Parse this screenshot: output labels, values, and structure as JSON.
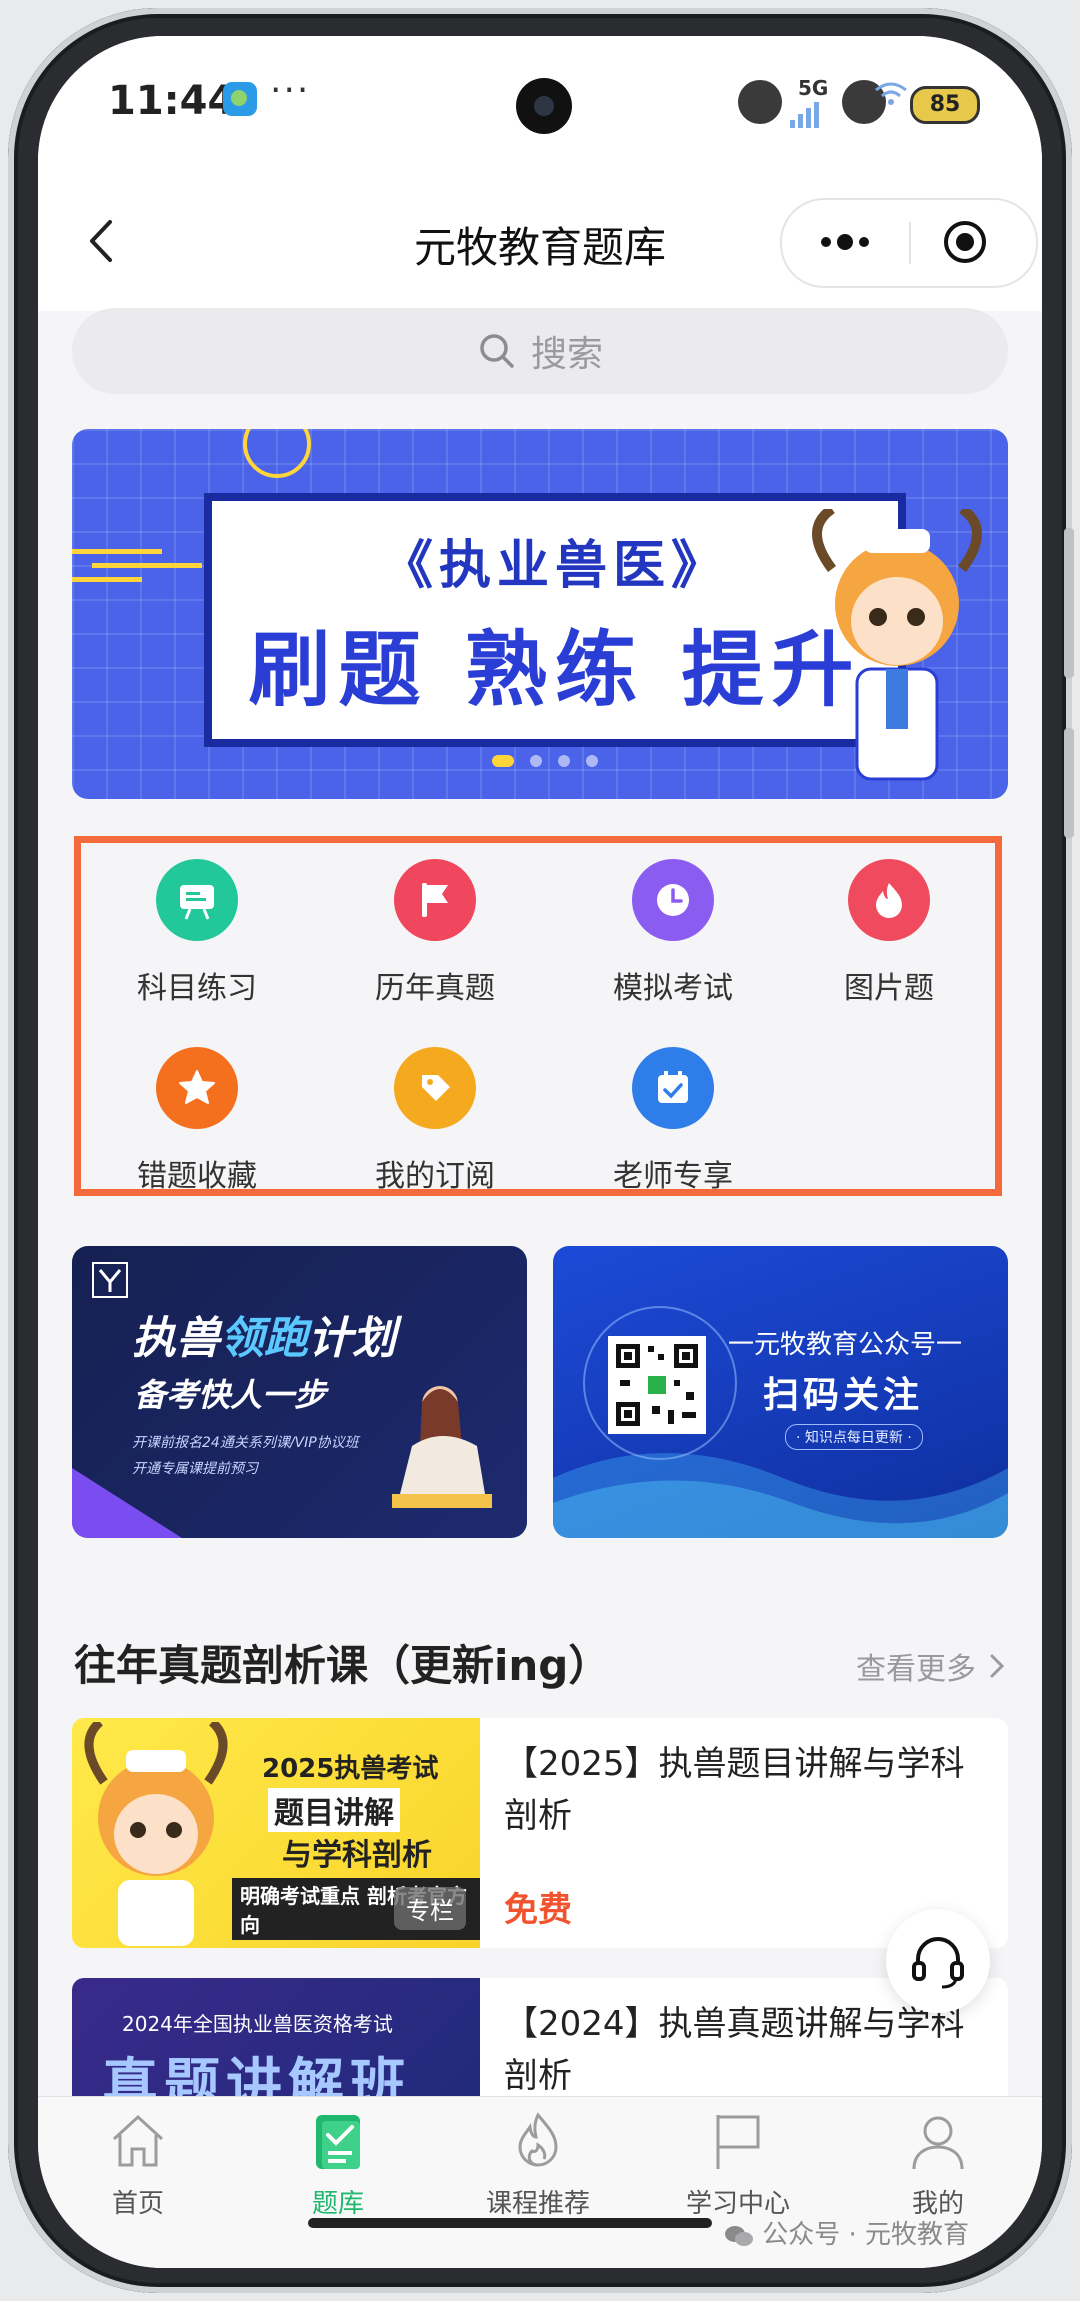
{
  "status_bar": {
    "time": "11:44",
    "network": "5G",
    "battery": "85"
  },
  "nav": {
    "title": "元牧教育题库"
  },
  "search": {
    "placeholder": "搜索"
  },
  "banner": {
    "line1": "《执业兽医》",
    "line2": "刷题 熟练 提升",
    "slides": 4,
    "active_slide": 1
  },
  "grid": {
    "items": [
      {
        "label": "科目练习",
        "icon": "whiteboard-icon",
        "color": "#22c79a"
      },
      {
        "label": "历年真题",
        "icon": "flag-icon",
        "color": "#f0475f"
      },
      {
        "label": "模拟考试",
        "icon": "clock-icon",
        "color": "#8a5cf0"
      },
      {
        "label": "图片题",
        "icon": "flame-icon",
        "color": "#f04a5e"
      },
      {
        "label": "错题收藏",
        "icon": "star-icon",
        "color": "#f5701e"
      },
      {
        "label": "我的订阅",
        "icon": "tag-icon",
        "color": "#f5a91e"
      },
      {
        "label": "老师专享",
        "icon": "calendar-icon",
        "color": "#2e7de8"
      }
    ]
  },
  "promos": {
    "left": {
      "line1_a": "执兽",
      "line1_b": "领跑",
      "line1_c": "计划",
      "line2": "备考快人一步",
      "line3": "开课前报名24通关系列课/VIP协议班",
      "line4": "开通专属课提前预习"
    },
    "right": {
      "line1": "一元牧教育公众号一",
      "line2": "扫码关注",
      "line3": "· 知识点每日更新 ·"
    }
  },
  "section": {
    "title": "往年真题剖析课（更新ing）",
    "more": "查看更多"
  },
  "courses": [
    {
      "title": "【2025】执兽题目讲解与学科剖析",
      "price": "免费",
      "tag": "专栏",
      "thumb_line1": "2025执兽考试",
      "thumb_line2": "题目讲解",
      "thumb_line3": "与学科剖析",
      "thumb_line4": "明确考试重点 剖析考官方向"
    },
    {
      "title": "【2024】执兽真题讲解与学科剖析",
      "thumb_line1": "2024年全国执业兽医资格考试",
      "thumb_line2": "真题讲解班"
    }
  ],
  "tabbar": {
    "items": [
      {
        "label": "首页",
        "icon": "home-icon"
      },
      {
        "label": "题库",
        "icon": "question-bank-icon",
        "active": true
      },
      {
        "label": "课程推荐",
        "icon": "fire-icon"
      },
      {
        "label": "学习中心",
        "icon": "flag-icon"
      },
      {
        "label": "我的",
        "icon": "user-icon"
      }
    ]
  },
  "watermark": "公众号 · 元牧教育",
  "colors": {
    "accent_green": "#1fb86e",
    "highlight_border": "#f36b3b",
    "price_red": "#f0532d"
  }
}
